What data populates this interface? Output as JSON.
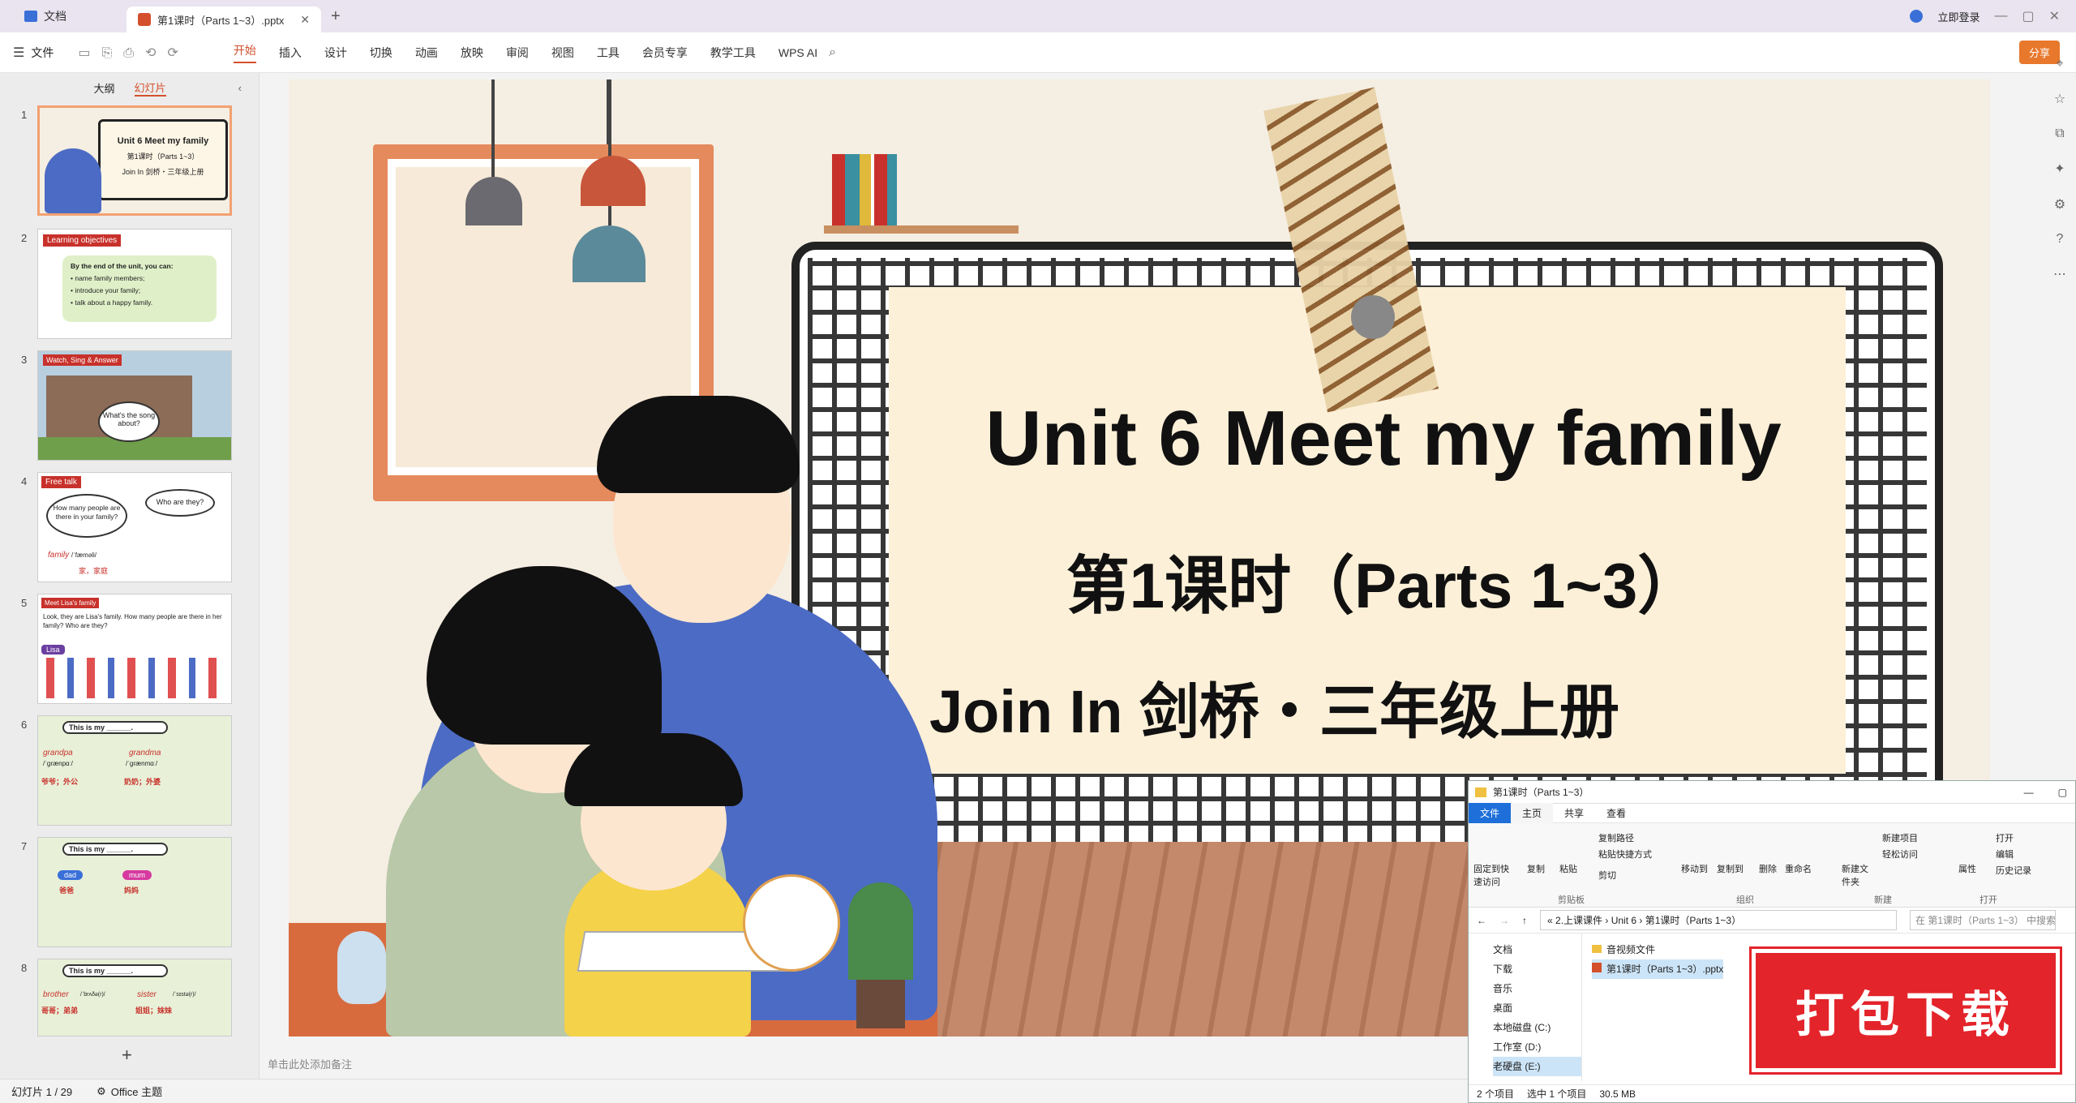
{
  "app": {
    "home_tab": "文档",
    "file_tab": "第1课时（Parts 1~3）.pptx",
    "login": "立即登录",
    "share": "分享"
  },
  "menu": {
    "file": "文件",
    "tabs": [
      "开始",
      "插入",
      "设计",
      "切换",
      "动画",
      "放映",
      "审阅",
      "视图",
      "工具",
      "会员专享",
      "教学工具",
      "WPS AI"
    ]
  },
  "panel": {
    "outline": "大纲",
    "slides": "幻灯片"
  },
  "thumbs": [
    {
      "num": "1",
      "title": "Unit 6 Meet my family",
      "sub": "第1课时（Parts 1~3）",
      "sub2": "Join In 剑桥・三年级上册"
    },
    {
      "num": "2",
      "title": "Learning objectives",
      "lines": [
        "By the end of the unit, you can:",
        "name family members;",
        "introduce your family;",
        "talk about a happy family."
      ]
    },
    {
      "num": "3",
      "title": "Watch, Sing & Answer",
      "bubble": "What's the song about?"
    },
    {
      "num": "4",
      "title": "Free talk",
      "q1": "How many people are there in your family?",
      "q2": "Who are they?",
      "word": "family",
      "phon": "/ˈfæməli/",
      "cn": "家，家庭"
    },
    {
      "num": "5",
      "title": "Meet Lisa's family",
      "text": "Look, they are Lisa's family. How many people are there in her family? Who are they?",
      "tag": "Lisa"
    },
    {
      "num": "6",
      "title": "This is my ______.",
      "w1": "grandpa",
      "w2": "grandma",
      "cn1": "爷爷；外公",
      "cn2": "奶奶；外婆",
      "p1": "/ˈɡrænpɑː/",
      "p2": "/ˈɡrænmɑː/"
    },
    {
      "num": "7",
      "title": "This is my ______.",
      "w1": "dad",
      "w2": "mum",
      "cn1": "爸爸",
      "cn2": "妈妈"
    },
    {
      "num": "8",
      "title": "This is my ______.",
      "w1": "brother",
      "w2": "sister",
      "cn1": "哥哥；弟弟",
      "cn2": "姐姐；妹妹",
      "p1": "/ˈbrʌðə(r)/",
      "p2": "/ˈsɪstə(r)/"
    }
  ],
  "slide": {
    "title": "Unit 6 Meet my family",
    "sub": "第1课时（Parts 1~3）",
    "sub2": "Join In 剑桥・三年级上册"
  },
  "notes": "单击此处添加备注",
  "status": {
    "page": "幻灯片 1 / 29",
    "theme": "Office 主题"
  },
  "explorer": {
    "title": "第1课时（Parts 1~3）",
    "tabs": [
      "文件",
      "主页",
      "共享",
      "查看"
    ],
    "groups": [
      "剪贴板",
      "组织",
      "新建",
      "打开"
    ],
    "cmds": [
      "固定到快速访问",
      "复制",
      "粘贴",
      "复制路径",
      "粘贴快捷方式",
      "剪切",
      "移动到",
      "复制到",
      "删除",
      "重命名",
      "新建文件夹",
      "新建项目",
      "轻松访问",
      "属性",
      "打开",
      "编辑",
      "历史记录"
    ],
    "path": [
      "2.上课课件",
      "Unit 6",
      "第1课时（Parts 1~3）"
    ],
    "search": "在 第1课时（Parts 1~3） 中搜索",
    "nav": [
      "文档",
      "下载",
      "音乐",
      "桌面",
      "本地磁盘 (C:)",
      "工作室 (D:)",
      "老硬盘 (E:)"
    ],
    "files": [
      "音视频文件",
      "第1课时（Parts 1~3）.pptx"
    ],
    "status": [
      "2 个项目",
      "选中 1 个项目",
      "30.5 MB"
    ]
  },
  "promo": "打包下载",
  "colors": {
    "accent": "#d4502c",
    "promo": "#e3242b",
    "slide_bg": "#f5eee2"
  }
}
